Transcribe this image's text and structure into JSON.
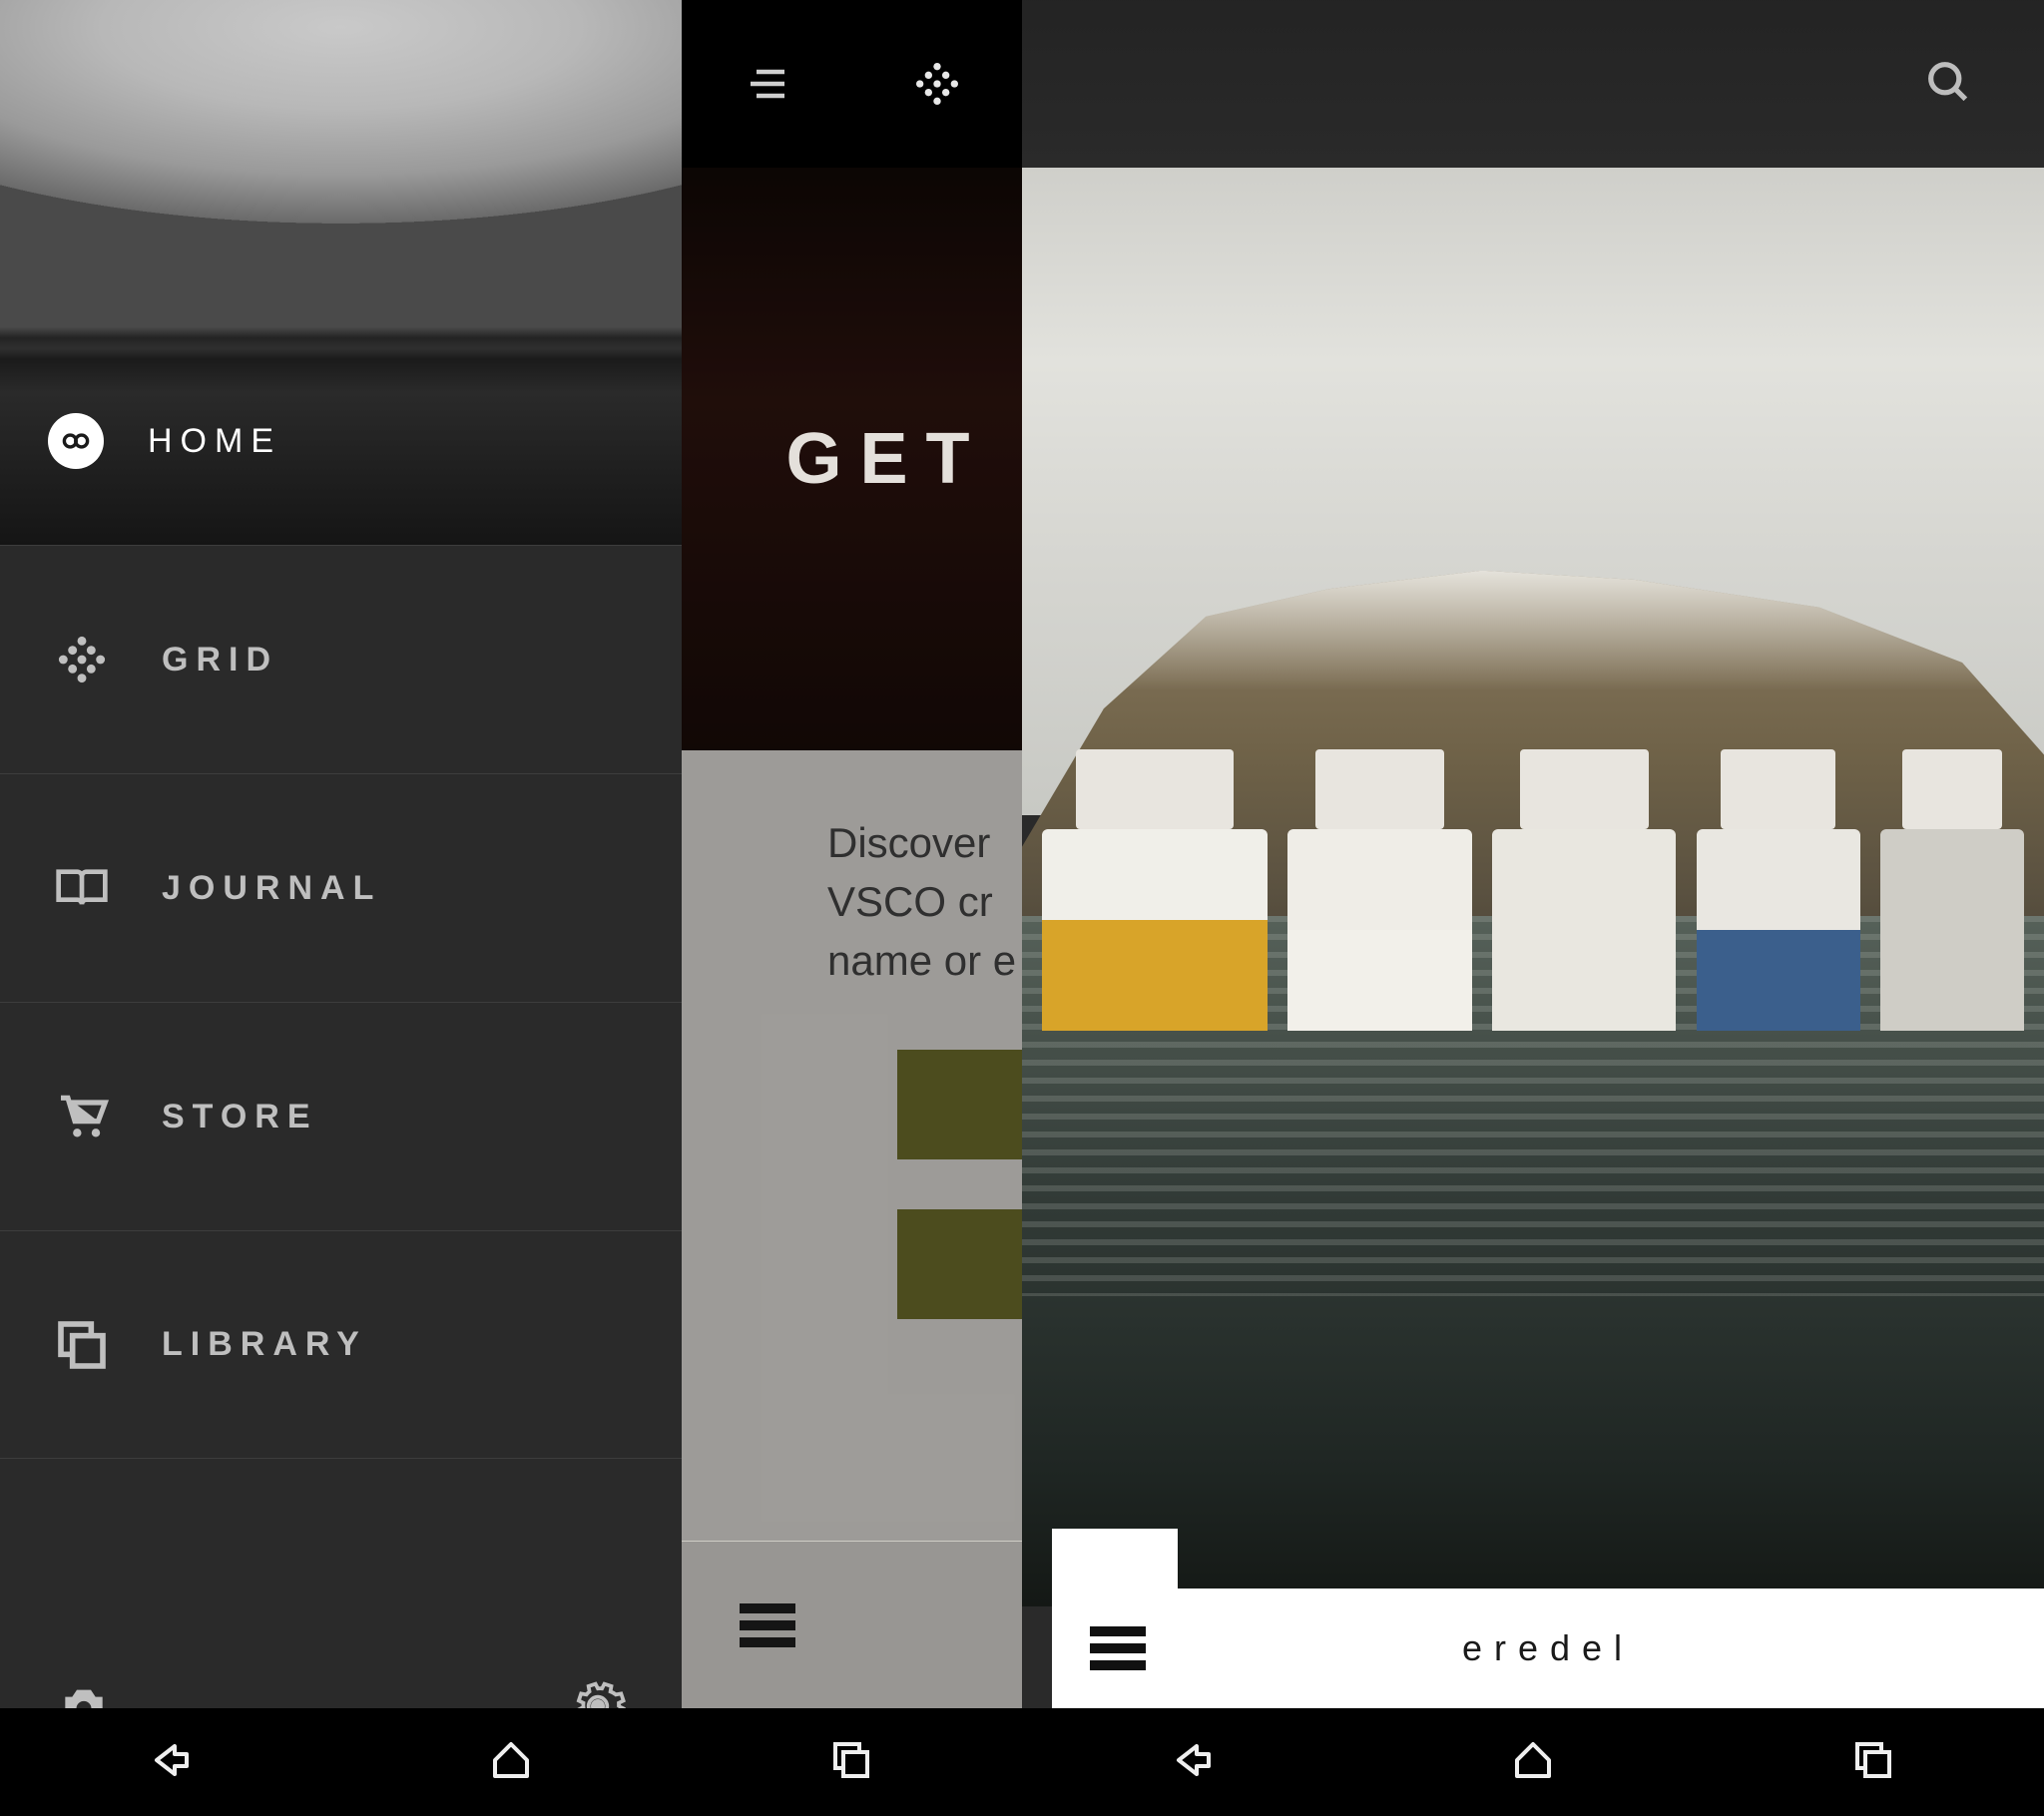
{
  "left_panel": {
    "home_label": "HOME",
    "items": [
      {
        "label": "GRID",
        "icon": "grid-diamond-icon"
      },
      {
        "label": "JOURNAL",
        "icon": "book-open-icon"
      },
      {
        "label": "STORE",
        "icon": "cart-icon"
      },
      {
        "label": "LIBRARY",
        "icon": "stack-icon"
      }
    ],
    "bottom": {
      "left_icon": "camera-icon",
      "right_icon": "gear-icon"
    }
  },
  "middle_panel": {
    "hero_title": "GET",
    "body_lines": [
      "Discover",
      "VSCO cr",
      "name or e"
    ]
  },
  "right_panel": {
    "username": "eredel"
  },
  "system_nav": {
    "back_icon": "back-icon",
    "home_icon": "home-outline-icon",
    "recent_icon": "recent-apps-icon"
  }
}
